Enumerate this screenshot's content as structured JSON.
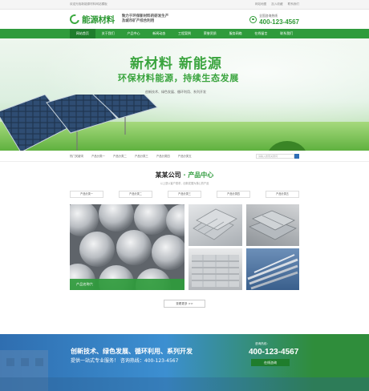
{
  "topbar": {
    "welcome": "欢迎光临新能源材料网站模板",
    "links": [
      "网站地图",
      "加入收藏",
      "联系我们"
    ]
  },
  "header": {
    "logo": "能源材料",
    "slogan": "致力于环保新材料的研发生产及城市矿产综合利用",
    "hotline_label": "全国咨询热线",
    "hotline": "400-123-4567"
  },
  "nav": [
    "网站首页",
    "关于我们",
    "产品中心",
    "新闻动态",
    "工程案例",
    "荣誉资质",
    "服务网络",
    "在线留言",
    "联系我们"
  ],
  "hero": {
    "title": "新材料 新能源",
    "subtitle": "环保材料能源，持续生态发展",
    "desc": "创新技术、绿色发展、循环利用、系列开发"
  },
  "breadcrumbs": [
    "热门关键词",
    "产品分类一",
    "产品分类二",
    "产品分类三",
    "产品分类四",
    "产品分类五"
  ],
  "search": {
    "placeholder": "请输入搜索关键词"
  },
  "section": {
    "company": "某某公司",
    "dot": "·",
    "title": "产品中心",
    "sub": "以上是以客户需求，创新发展为核心的产品"
  },
  "categories": [
    "产品分类一",
    "产品分类二",
    "产品分类三",
    "产品分类四",
    "产品分类五"
  ],
  "products": [
    {
      "caption": "产品名称六"
    }
  ],
  "more": "查看更多 >>",
  "banner": {
    "line1": "创新技术、绿色发展、循环利用、系列开发",
    "line2": "提供一站式专业服务！  咨询热线：400-123-4567",
    "tel_label": "咨询热线：",
    "tel": "400-123-4567",
    "cta": "在线咨询"
  }
}
